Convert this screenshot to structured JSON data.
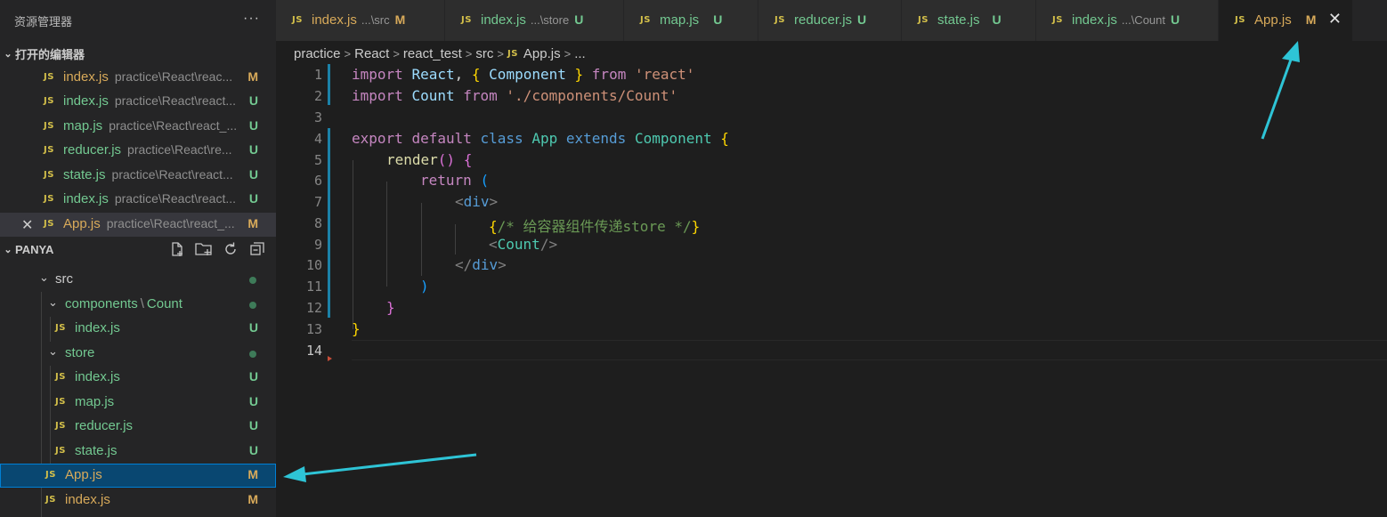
{
  "sidebar": {
    "title": "资源管理器",
    "more": "···",
    "open_editors": {
      "title": "打开的编辑器",
      "items": [
        {
          "icon": "JS",
          "name": "index.js",
          "desc": "practice\\React\\reac...",
          "status": "M"
        },
        {
          "icon": "JS",
          "name": "index.js",
          "desc": "practice\\React\\react...",
          "status": "U"
        },
        {
          "icon": "JS",
          "name": "map.js",
          "desc": "practice\\React\\react_...",
          "status": "U"
        },
        {
          "icon": "JS",
          "name": "reducer.js",
          "desc": "practice\\React\\re...",
          "status": "U"
        },
        {
          "icon": "JS",
          "name": "state.js",
          "desc": "practice\\React\\react...",
          "status": "U"
        },
        {
          "icon": "JS",
          "name": "index.js",
          "desc": "practice\\React\\react...",
          "status": "U"
        },
        {
          "icon": "JS",
          "name": "App.js",
          "desc": "practice\\React\\react_...",
          "status": "M"
        }
      ]
    },
    "workspace": {
      "title": "PANYA",
      "tree": [
        {
          "name": "src",
          "status": ""
        },
        {
          "name": "components",
          "sep": "\\",
          "name2": "Count",
          "status": ""
        },
        {
          "name": "index.js",
          "icon": "JS",
          "status": "U"
        },
        {
          "name": "store",
          "status": ""
        },
        {
          "name": "index.js",
          "icon": "JS",
          "status": "U"
        },
        {
          "name": "map.js",
          "icon": "JS",
          "status": "U"
        },
        {
          "name": "reducer.js",
          "icon": "JS",
          "status": "U"
        },
        {
          "name": "state.js",
          "icon": "JS",
          "status": "U"
        },
        {
          "name": "App.js",
          "icon": "JS",
          "status": "M"
        },
        {
          "name": "index.js",
          "icon": "JS",
          "status": "M"
        }
      ]
    }
  },
  "tabs": [
    {
      "icon": "JS",
      "name": "index.js",
      "desc": "...\\src",
      "status": "M"
    },
    {
      "icon": "JS",
      "name": "index.js",
      "desc": "...\\store",
      "status": "U"
    },
    {
      "icon": "JS",
      "name": "map.js",
      "desc": "",
      "status": "U"
    },
    {
      "icon": "JS",
      "name": "reducer.js",
      "desc": "",
      "status": "U"
    },
    {
      "icon": "JS",
      "name": "state.js",
      "desc": "",
      "status": "U"
    },
    {
      "icon": "JS",
      "name": "index.js",
      "desc": "...\\Count",
      "status": "U"
    },
    {
      "icon": "JS",
      "name": "App.js",
      "desc": "",
      "status": "M",
      "close": "✕"
    }
  ],
  "breadcrumb": {
    "parts": [
      "practice",
      "React",
      "react_test",
      "src"
    ],
    "file_icon": "JS",
    "file": "App.js",
    "tail": "..."
  },
  "editor": {
    "line_numbers": [
      "1",
      "2",
      "3",
      "4",
      "5",
      "6",
      "7",
      "8",
      "9",
      "10",
      "11",
      "12",
      "13",
      "14"
    ],
    "code": {
      "l1": [
        "import",
        "React",
        ",",
        "{",
        "Component",
        "}",
        "from",
        "'react'"
      ],
      "l2": [
        "import",
        "Count",
        "from",
        "'./components/Count'"
      ],
      "l4": [
        "export",
        "default",
        "class",
        "App",
        "extends",
        "Component",
        "{"
      ],
      "l5": [
        "render",
        "()",
        "{"
      ],
      "l6": [
        "return",
        "("
      ],
      "l7": [
        "<",
        "div",
        ">"
      ],
      "l8": [
        "{",
        "/* 给容器组件传递store */",
        "}"
      ],
      "l9": [
        "<",
        "Count",
        "/>"
      ],
      "l10": [
        "</",
        "div",
        ">"
      ],
      "l11": [
        ")"
      ],
      "l12": [
        "}"
      ],
      "l13": [
        "}"
      ]
    }
  },
  "colors": {
    "accent_arrow": "#2ec4d6",
    "modified": "#d8aa5a",
    "untracked": "#73c991",
    "selection": "#094771"
  }
}
